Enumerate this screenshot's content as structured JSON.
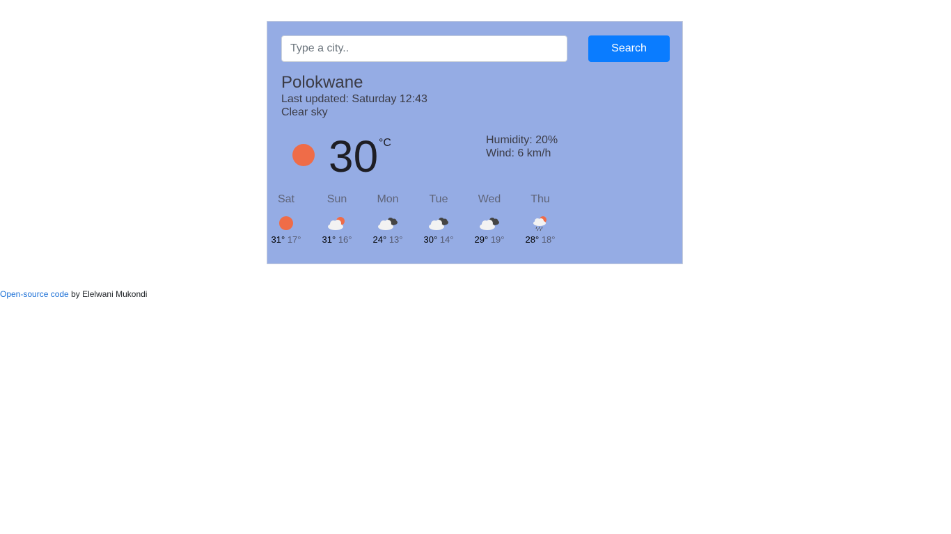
{
  "search": {
    "placeholder": "Type a city..",
    "button_label": "Search"
  },
  "current": {
    "city": "Polokwane",
    "last_updated": "Last updated: Saturday 12:43",
    "description": "Clear sky",
    "temperature": "30",
    "unit": "°C",
    "icon": "sun-icon",
    "humidity": "Humidity: 20%",
    "wind": "Wind: 6 km/h"
  },
  "forecast": [
    {
      "day": "Sat",
      "icon": "sun-icon",
      "max": "31°",
      "min": "17°"
    },
    {
      "day": "Sun",
      "icon": "partly-cloudy-icon",
      "max": "31°",
      "min": "16°"
    },
    {
      "day": "Mon",
      "icon": "broken-clouds-icon",
      "max": "24°",
      "min": "13°"
    },
    {
      "day": "Tue",
      "icon": "broken-clouds-icon",
      "max": "30°",
      "min": "14°"
    },
    {
      "day": "Wed",
      "icon": "broken-clouds-icon",
      "max": "29°",
      "min": "19°"
    },
    {
      "day": "Thu",
      "icon": "rain-icon",
      "max": "28°",
      "min": "18°"
    }
  ],
  "footer": {
    "link_text": "Open-source code",
    "suffix": " by Elelwani Mukondi"
  },
  "colors": {
    "card_background": "#95ace4",
    "button": "#0a7cff",
    "sun": "#ef6c48",
    "link": "#1a6fd6"
  }
}
